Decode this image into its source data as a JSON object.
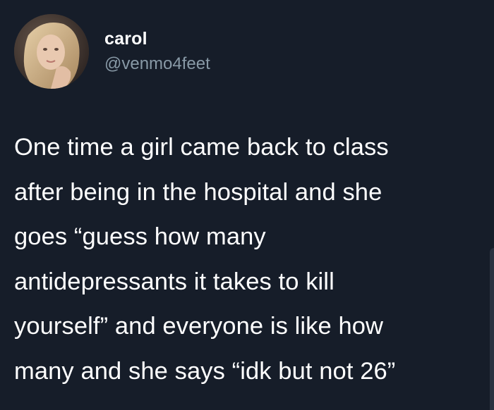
{
  "author": {
    "display_name": "carol",
    "handle": "@venmo4feet",
    "avatar_icon": "profile-photo"
  },
  "tweet": {
    "text": "One time a girl came back to class\nafter being in the hospital and she\ngoes “guess how many\nantidepressants it takes to kill\nyourself” and everyone is like how\nmany and she says “idk but not 26”"
  },
  "colors": {
    "background": "#161d29",
    "text": "#ffffff",
    "handle": "#8899a6"
  }
}
